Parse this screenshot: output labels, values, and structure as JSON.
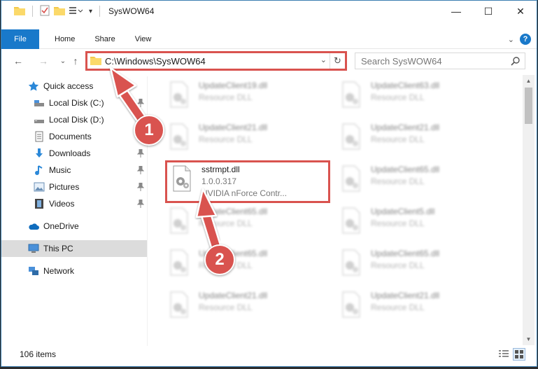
{
  "window": {
    "title": "SysWOW64",
    "controls": {
      "minimize": "—",
      "maximize": "☐",
      "close": "✕"
    }
  },
  "ribbon": {
    "tabs": [
      {
        "label": "File"
      },
      {
        "label": "Home"
      },
      {
        "label": "Share"
      },
      {
        "label": "View"
      }
    ],
    "collapse": "⌄",
    "help": "?"
  },
  "address": {
    "path": "C:\\Windows\\SysWOW64",
    "dropdown": "⌄",
    "refresh": "↻"
  },
  "nav": {
    "back": "←",
    "forward": "→",
    "recent": "⌄",
    "up": "↑"
  },
  "search": {
    "placeholder": "Search SysWOW64"
  },
  "sidebar": {
    "items": [
      {
        "label": "Quick access",
        "icon": "star-icon"
      },
      {
        "label": "Local Disk (C:)",
        "icon": "drive-icon"
      },
      {
        "label": "Local Disk (D:)",
        "icon": "drive-icon"
      },
      {
        "label": "Documents",
        "icon": "documents-icon"
      },
      {
        "label": "Downloads",
        "icon": "download-icon"
      },
      {
        "label": "Music",
        "icon": "music-icon"
      },
      {
        "label": "Pictures",
        "icon": "pictures-icon"
      },
      {
        "label": "Videos",
        "icon": "videos-icon"
      },
      {
        "label": "OneDrive",
        "icon": "cloud-icon"
      },
      {
        "label": "This PC",
        "icon": "computer-icon"
      },
      {
        "label": "Network",
        "icon": "network-icon"
      }
    ]
  },
  "files": {
    "left": [
      {
        "name": "UpdateClient19.dll",
        "sub": "Resource DLL"
      },
      {
        "name": "UpdateClient21.dll",
        "sub": "Resource DLL"
      },
      {
        "name": "sstrmpt.dll",
        "version": "1.0.0.317",
        "desc": "NVIDIA nForce Contr..."
      },
      {
        "name": "UpdateClient65.dll",
        "sub": "Resource DLL"
      },
      {
        "name": "UpdateClient65.dll",
        "sub": "Resource DLL"
      },
      {
        "name": "UpdateClient21.dll",
        "sub": "Resource DLL"
      }
    ],
    "right": [
      {
        "name": "UpdateClient63.dll",
        "sub": "Resource DLL"
      },
      {
        "name": "UpdateClient21.dll",
        "sub": "Resource DLL"
      },
      {
        "name": "UpdateClient65.dll",
        "sub": "Resource DLL"
      },
      {
        "name": "UpdateClient5.dll",
        "sub": "Resource DLL"
      },
      {
        "name": "UpdateClient65.dll",
        "sub": "Resource DLL"
      },
      {
        "name": "UpdateClient21.dll",
        "sub": "Resource DLL"
      }
    ]
  },
  "status": {
    "count": "106 items"
  },
  "annotations": {
    "step1": "1",
    "step2": "2"
  },
  "colors": {
    "accent": "#1979ca",
    "highlight": "#d9534f"
  }
}
